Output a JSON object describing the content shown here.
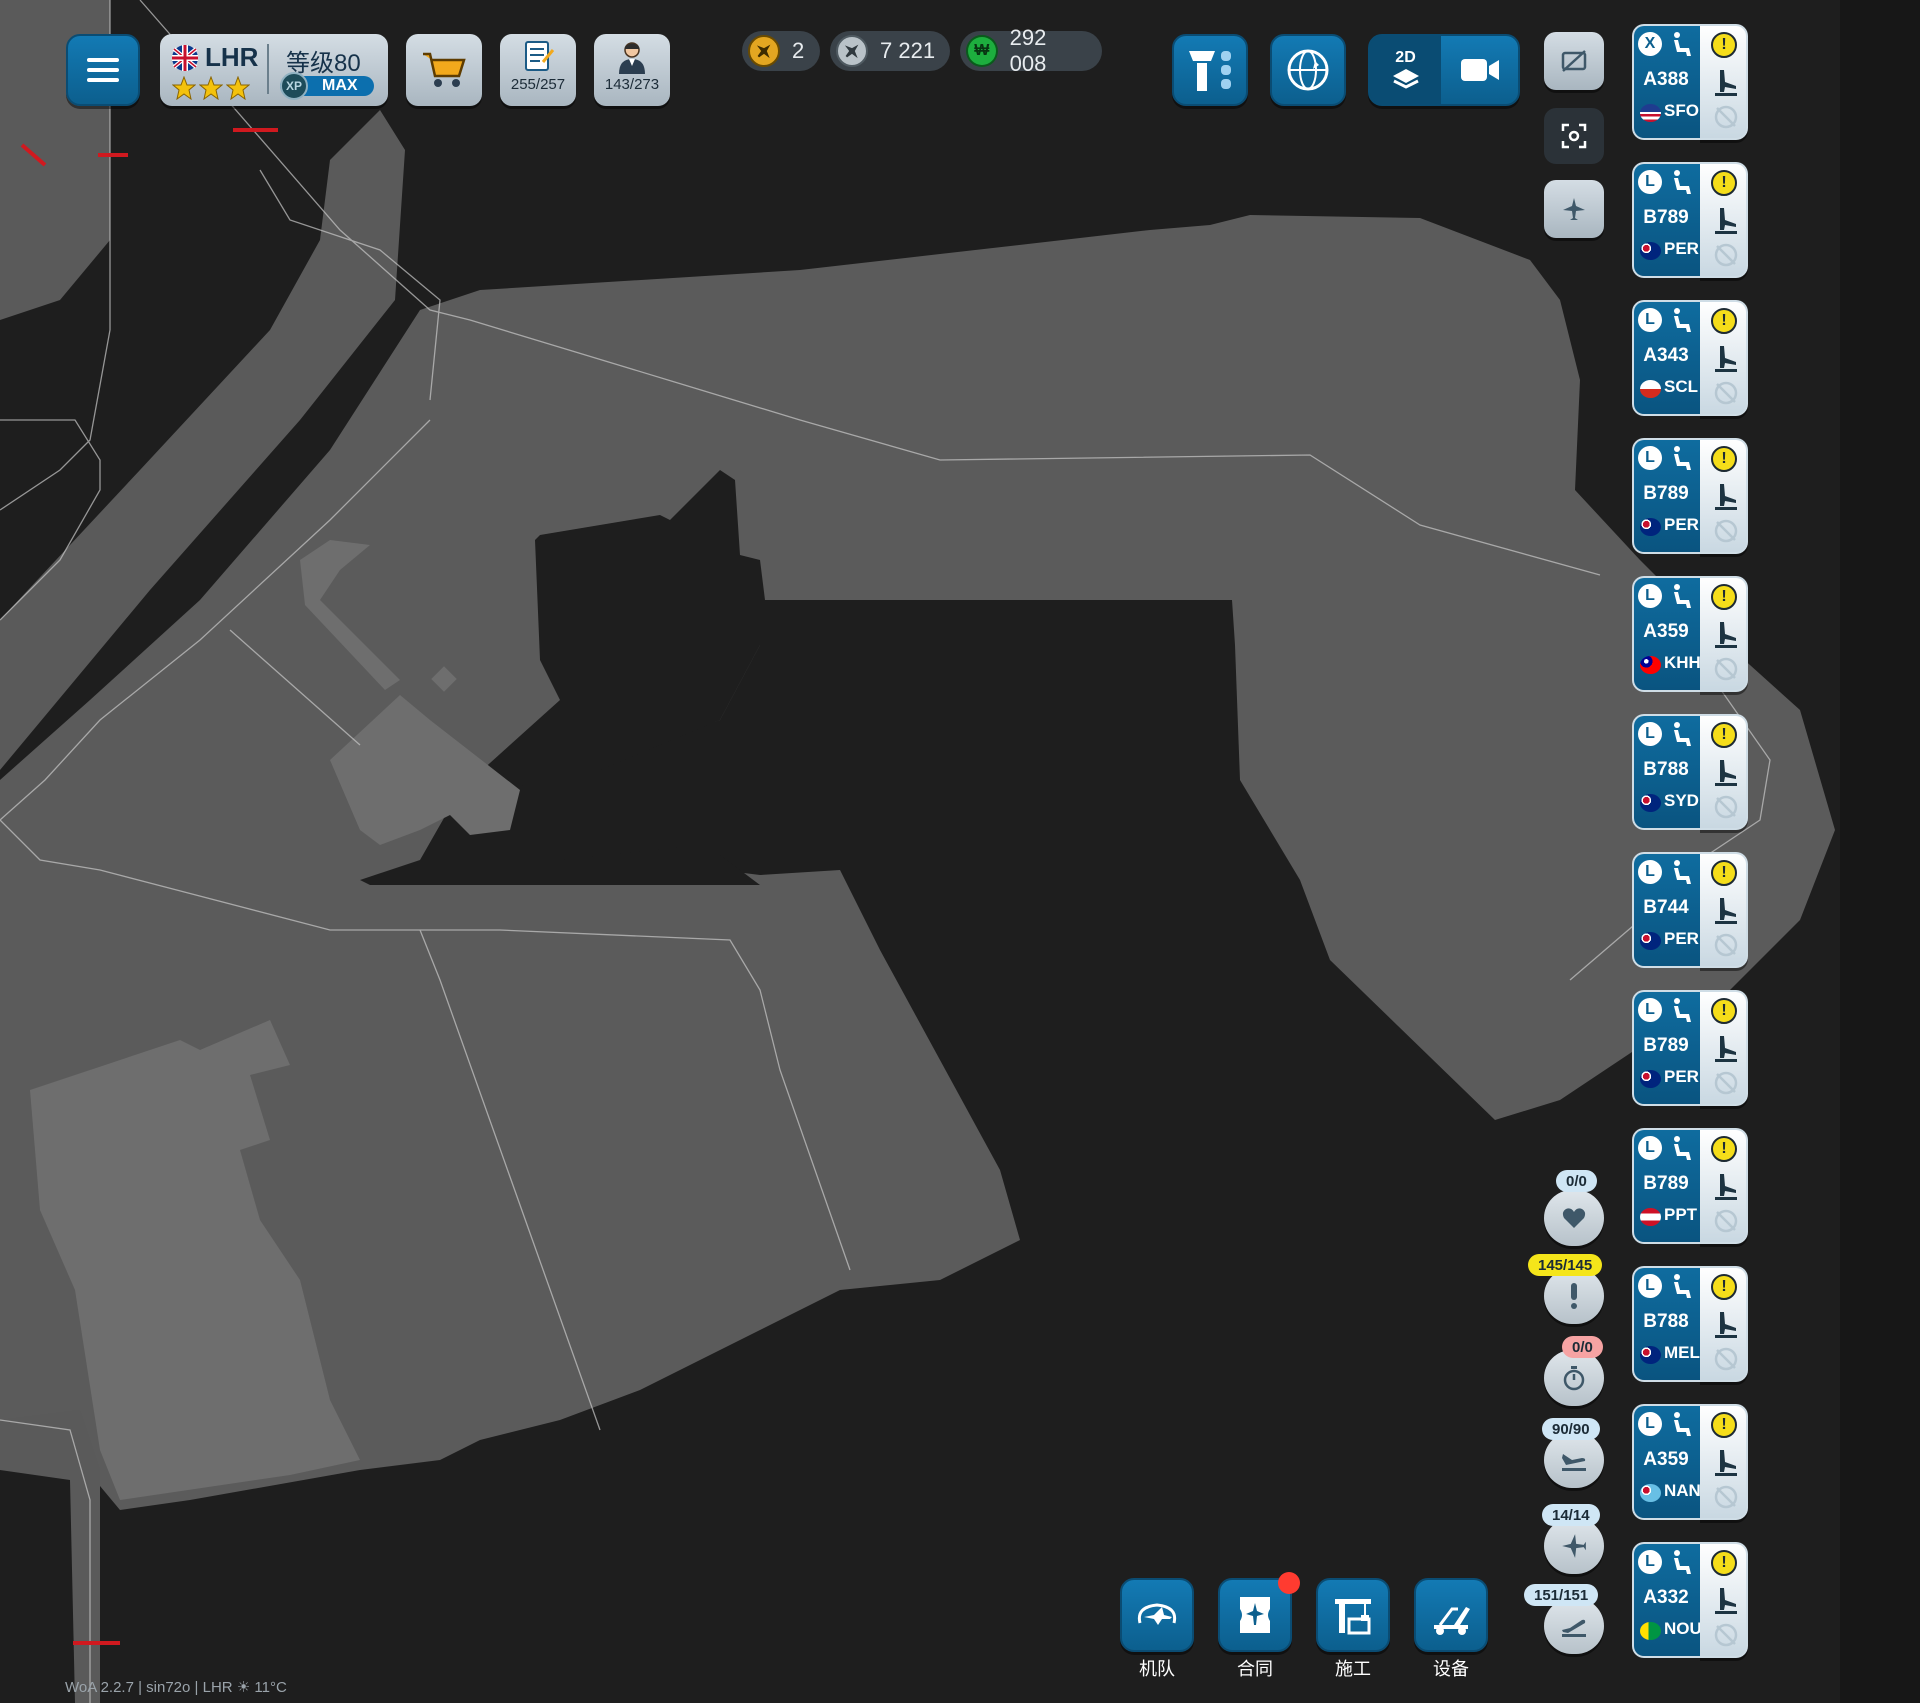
{
  "header": {
    "airport_code": "LHR",
    "level_label": "等级80",
    "xp_badge": "XP",
    "xp_value": "MAX",
    "stars": 3,
    "contracts_count": "255/257",
    "staff_count": "143/273"
  },
  "resources": {
    "planes": "2",
    "coins": "7 221",
    "money": "292 008"
  },
  "toolbar": {
    "view_mode_label": "2D"
  },
  "side_counters": {
    "favorites": "0/0",
    "alerts": "145/145",
    "timers": "0/0",
    "arrivals": "90/90",
    "airborne": "14/14",
    "departures": "151/151"
  },
  "flights": [
    {
      "class": "X",
      "type": "A388",
      "dest": "SFO",
      "flag": "us"
    },
    {
      "class": "L",
      "type": "B789",
      "dest": "PER",
      "flag": "au"
    },
    {
      "class": "L",
      "type": "A343",
      "dest": "SCL",
      "flag": "cl"
    },
    {
      "class": "L",
      "type": "B789",
      "dest": "PER",
      "flag": "au"
    },
    {
      "class": "L",
      "type": "A359",
      "dest": "KHH",
      "flag": "tw"
    },
    {
      "class": "L",
      "type": "B788",
      "dest": "SYD",
      "flag": "au"
    },
    {
      "class": "L",
      "type": "B744",
      "dest": "PER",
      "flag": "au"
    },
    {
      "class": "L",
      "type": "B789",
      "dest": "PER",
      "flag": "au"
    },
    {
      "class": "L",
      "type": "B789",
      "dest": "PPT",
      "flag": "pf"
    },
    {
      "class": "L",
      "type": "B788",
      "dest": "MEL",
      "flag": "au"
    },
    {
      "class": "L",
      "type": "A359",
      "dest": "NAN",
      "flag": "fj"
    },
    {
      "class": "L",
      "type": "A332",
      "dest": "NOU",
      "flag": "nc"
    }
  ],
  "bottom_nav": {
    "fleet": "机队",
    "contracts": "合同",
    "construction": "施工",
    "equipment": "设备"
  },
  "footer": {
    "version": "WoA 2.2.7 | sin72o | LHR ☀ 11°C"
  },
  "colors": {
    "primary_blue": "#0c5f8e",
    "warning_yellow": "#f5dd1a",
    "notification_red": "#ff3b30",
    "map_ground": "#5b5b5b",
    "map_background": "#1e1e1e"
  }
}
